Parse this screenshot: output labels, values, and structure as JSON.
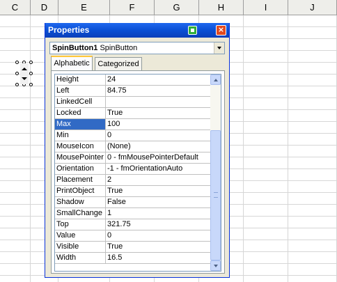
{
  "spreadsheet": {
    "columns": [
      "C",
      "D",
      "E",
      "F",
      "G",
      "H",
      "I",
      "J"
    ]
  },
  "properties_window": {
    "title": "Properties",
    "close_glyph": "×",
    "object": {
      "name": "SpinButton1",
      "type": "SpinButton"
    },
    "tabs": [
      "Alphabetic",
      "Categorized"
    ],
    "active_tab": "Alphabetic",
    "selected_property": "Max",
    "properties": [
      {
        "name": "Height",
        "value": "24"
      },
      {
        "name": "Left",
        "value": "84.75"
      },
      {
        "name": "LinkedCell",
        "value": ""
      },
      {
        "name": "Locked",
        "value": "True"
      },
      {
        "name": "Max",
        "value": "100"
      },
      {
        "name": "Min",
        "value": "0"
      },
      {
        "name": "MouseIcon",
        "value": "(None)"
      },
      {
        "name": "MousePointer",
        "value": "0 - fmMousePointerDefault"
      },
      {
        "name": "Orientation",
        "value": "-1 - fmOrientationAuto"
      },
      {
        "name": "Placement",
        "value": "2"
      },
      {
        "name": "PrintObject",
        "value": "True"
      },
      {
        "name": "Shadow",
        "value": "False"
      },
      {
        "name": "SmallChange",
        "value": "1"
      },
      {
        "name": "Top",
        "value": "321.75"
      },
      {
        "name": "Value",
        "value": "0"
      },
      {
        "name": "Visible",
        "value": "True"
      },
      {
        "name": "Width",
        "value": "16.5"
      }
    ]
  },
  "icons": {
    "title_green": "green-square-icon",
    "title_close": "close-icon",
    "dropdown": "chevron-down-icon",
    "scroll_up": "arrow-up-icon",
    "scroll_down": "arrow-down-icon"
  },
  "colors": {
    "titlebar": "#0a4fd4",
    "selection": "#316ac5",
    "close": "#e24a1f",
    "green": "#2fae3a"
  }
}
